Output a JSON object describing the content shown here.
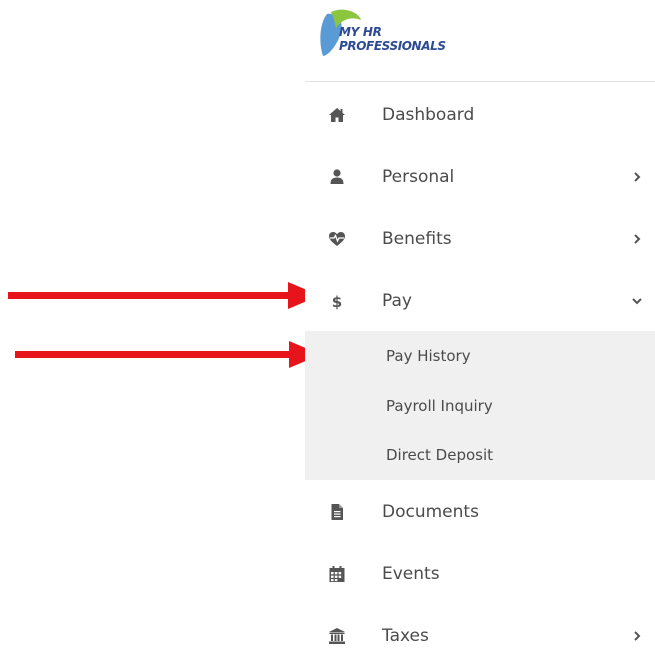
{
  "logo": {
    "line1": "MY HR",
    "line2": "PROFESSIONALS",
    "colors": {
      "text": "#2d4a94",
      "blue_leaf": "#5b9bd5",
      "green_leaf": "#8cc63f"
    }
  },
  "menu": {
    "items": [
      {
        "id": "dashboard",
        "label": "Dashboard",
        "icon": "home-icon",
        "has_children": false
      },
      {
        "id": "personal",
        "label": "Personal",
        "icon": "user-icon",
        "has_children": true,
        "expanded": false
      },
      {
        "id": "benefits",
        "label": "Benefits",
        "icon": "heartbeat-icon",
        "has_children": true,
        "expanded": false
      },
      {
        "id": "pay",
        "label": "Pay",
        "icon": "dollar-icon",
        "has_children": true,
        "expanded": true
      },
      {
        "id": "documents",
        "label": "Documents",
        "icon": "document-icon",
        "has_children": false
      },
      {
        "id": "events",
        "label": "Events",
        "icon": "calendar-icon",
        "has_children": false
      },
      {
        "id": "taxes",
        "label": "Taxes",
        "icon": "bank-icon",
        "has_children": true,
        "expanded": false
      }
    ],
    "pay_submenu": [
      {
        "id": "pay-history",
        "label": "Pay History"
      },
      {
        "id": "payroll-inquiry",
        "label": "Payroll Inquiry"
      },
      {
        "id": "direct-deposit",
        "label": "Direct Deposit"
      }
    ]
  },
  "colors": {
    "text": "#4b4b4b",
    "icon": "#555555",
    "submenu_bg": "#f0f0f0",
    "divider": "#e2e2e2",
    "annotation_arrow": "#e8141b"
  }
}
